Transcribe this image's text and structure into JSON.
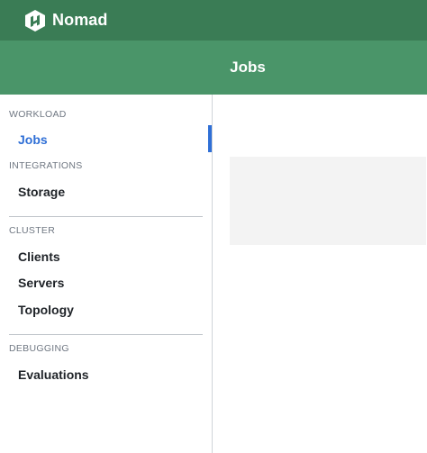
{
  "app": {
    "name": "Nomad",
    "logo_icon": "nomad-logo-icon"
  },
  "header": {
    "title": "Jobs"
  },
  "sidebar": {
    "sections": [
      {
        "heading": "WORKLOAD",
        "items": [
          {
            "label": "Jobs",
            "active": true
          }
        ]
      },
      {
        "heading": "INTEGRATIONS",
        "items": [
          {
            "label": "Storage",
            "active": false
          }
        ]
      },
      {
        "heading": "CLUSTER",
        "items": [
          {
            "label": "Clients",
            "active": false
          },
          {
            "label": "Servers",
            "active": false
          },
          {
            "label": "Topology",
            "active": false
          }
        ]
      },
      {
        "heading": "DEBUGGING",
        "items": [
          {
            "label": "Evaluations",
            "active": false
          }
        ]
      }
    ]
  },
  "colors": {
    "topbar": "#3a7c55",
    "subheader": "#4a9569",
    "active_link": "#2f6fd6",
    "placeholder": "#f3f3f3"
  }
}
